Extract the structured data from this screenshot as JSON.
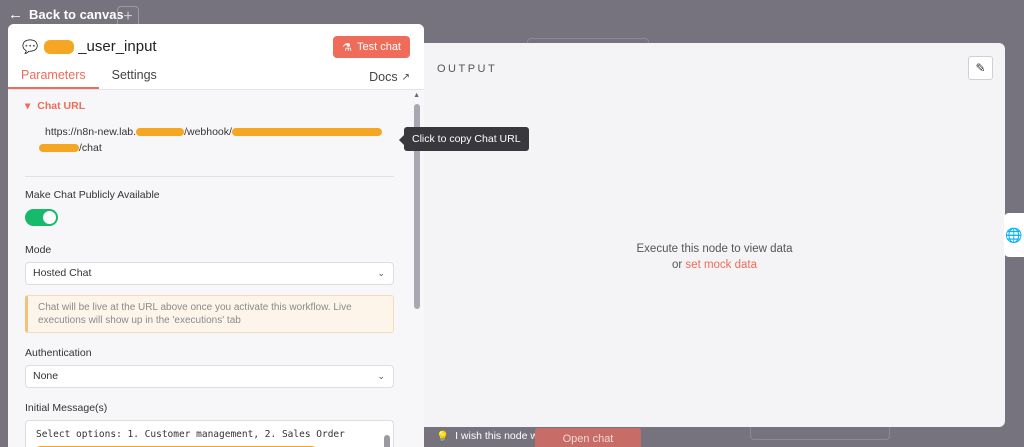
{
  "canvas": {
    "back_label": "Back to canvas",
    "plus_label": "+"
  },
  "node": {
    "title": "_user_input",
    "test_chat_label": "Test chat"
  },
  "tabs": [
    {
      "label": "Parameters"
    },
    {
      "label": "Settings"
    }
  ],
  "docs_label": "Docs",
  "parameters": {
    "chat_url_section": "Chat URL",
    "chat_url_line1": "https://n8n-new.lab.",
    "chat_url_mid": "/webhook/",
    "chat_url_end": "/chat",
    "tooltip": "Click to copy Chat URL",
    "public_label": "Make Chat Publicly Available",
    "public_enabled": true,
    "mode_label": "Mode",
    "mode_value": "Hosted Chat",
    "notice": "Chat will be live at the URL above once you activate this workflow. Live executions will show up in the 'executions' tab",
    "auth_label": "Authentication",
    "auth_value": "None",
    "initial_message_label": "Initial Message(s)",
    "initial_message_value": "Select options: 1. Customer management, 2. Sales Order"
  },
  "output": {
    "label": "OUTPUT",
    "empty_line1": "Execute this node to view data",
    "empty_or": "or",
    "mock_link": "set mock data"
  },
  "footer": {
    "wish": "I wish this node would...",
    "open_chat": "Open chat"
  },
  "colors": {
    "accent": "#ee6c59",
    "toggle_on": "#17b96b"
  },
  "icons": [
    "arrow-left-icon",
    "chat-bubbles-icon",
    "flask-icon",
    "external-link-icon",
    "chevron-down-icon",
    "pencil-icon",
    "globe-icon",
    "lightbulb-icon"
  ]
}
